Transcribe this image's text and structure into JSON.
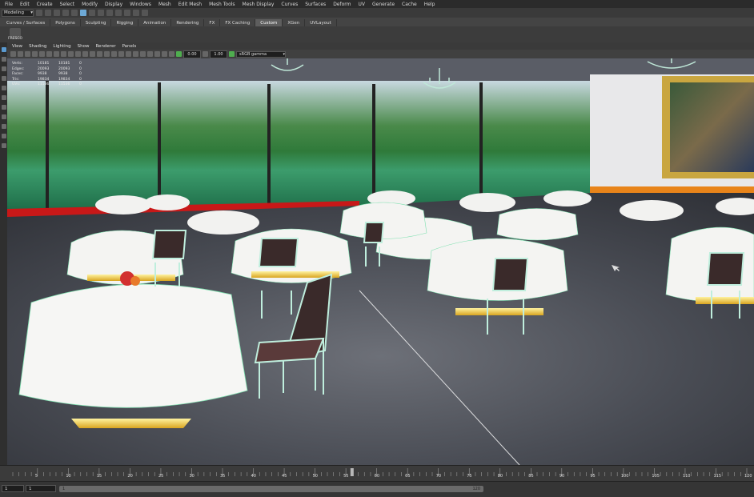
{
  "menubar": {
    "items": [
      "File",
      "Edit",
      "Create",
      "Select",
      "Modify",
      "Display",
      "Windows",
      "Mesh",
      "Edit Mesh",
      "Mesh Tools",
      "Mesh Display",
      "Curves",
      "Surfaces",
      "Deform",
      "UV",
      "Generate",
      "Cache",
      "Help"
    ]
  },
  "status_line": {
    "mode": "Modeling"
  },
  "shelf_tabs": {
    "tabs": [
      "Curves / Surfaces",
      "Polygons",
      "Sculpting",
      "Rigging",
      "Animation",
      "Rendering",
      "FX",
      "FX Caching",
      "Custom",
      "XGen",
      "UVLayout"
    ],
    "active": "Custom",
    "shelf_button_label": "FRESCO"
  },
  "panel_menu": {
    "items": [
      "View",
      "Shading",
      "Lighting",
      "Show",
      "Renderer",
      "Panels"
    ]
  },
  "panel_toolbar": {
    "exposure": "0.00",
    "gamma": "1.00",
    "color_space": "sRGB gamma"
  },
  "hud": {
    "rows": [
      {
        "label": "Verts:",
        "v1": "10181",
        "v2": "10181",
        "v3": "0"
      },
      {
        "label": "Edges:",
        "v1": "20093",
        "v2": "20093",
        "v3": "0"
      },
      {
        "label": "Faces:",
        "v1": "9938",
        "v2": "9938",
        "v3": "0"
      },
      {
        "label": "Tris:",
        "v1": "19834",
        "v2": "19834",
        "v3": "0"
      },
      {
        "label": "UVs:",
        "v1": "11536",
        "v2": "11536",
        "v3": "0"
      }
    ]
  },
  "time_slider": {
    "tick_labels": [
      "5",
      "10",
      "15",
      "20",
      "25",
      "30",
      "35",
      "40",
      "45",
      "50",
      "55",
      "60",
      "65",
      "70",
      "75",
      "80",
      "85",
      "90",
      "95",
      "100",
      "105",
      "110",
      "115",
      "120"
    ],
    "current_frame": 56
  },
  "range_slider": {
    "start": "1",
    "playback_start": "1",
    "range_start": "1",
    "range_end": "120"
  },
  "colors": {
    "accent": "#5a9ad0",
    "wire": "#7fe0b0",
    "tablecloth": "#f2f2f0",
    "gold": "#e8c33a"
  }
}
